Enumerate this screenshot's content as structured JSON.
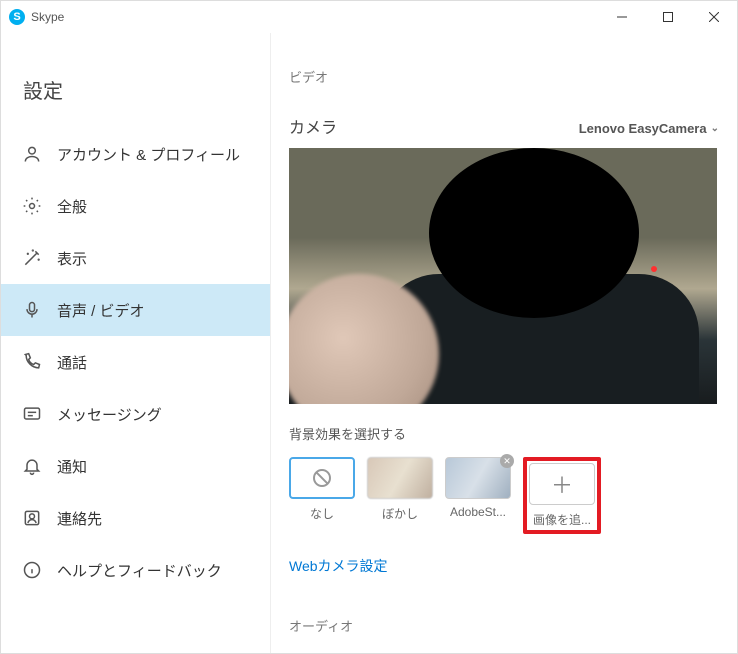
{
  "window": {
    "title": "Skype"
  },
  "sidebar": {
    "header": "設定",
    "items": [
      {
        "label": "アカウント & プロフィール"
      },
      {
        "label": "全般"
      },
      {
        "label": "表示"
      },
      {
        "label": "音声 / ビデオ"
      },
      {
        "label": "通話"
      },
      {
        "label": "メッセージング"
      },
      {
        "label": "通知"
      },
      {
        "label": "連絡先"
      },
      {
        "label": "ヘルプとフィードバック"
      }
    ]
  },
  "main": {
    "video_section": "ビデオ",
    "camera_label": "カメラ",
    "camera_selected": "Lenovo EasyCamera",
    "bg_label": "背景効果を選択する",
    "bg_options": [
      {
        "caption": "なし"
      },
      {
        "caption": "ぼかし"
      },
      {
        "caption": "AdobeSt..."
      },
      {
        "caption": "画像を追..."
      }
    ],
    "webcam_settings": "Webカメラ設定",
    "audio_section": "オーディオ"
  }
}
